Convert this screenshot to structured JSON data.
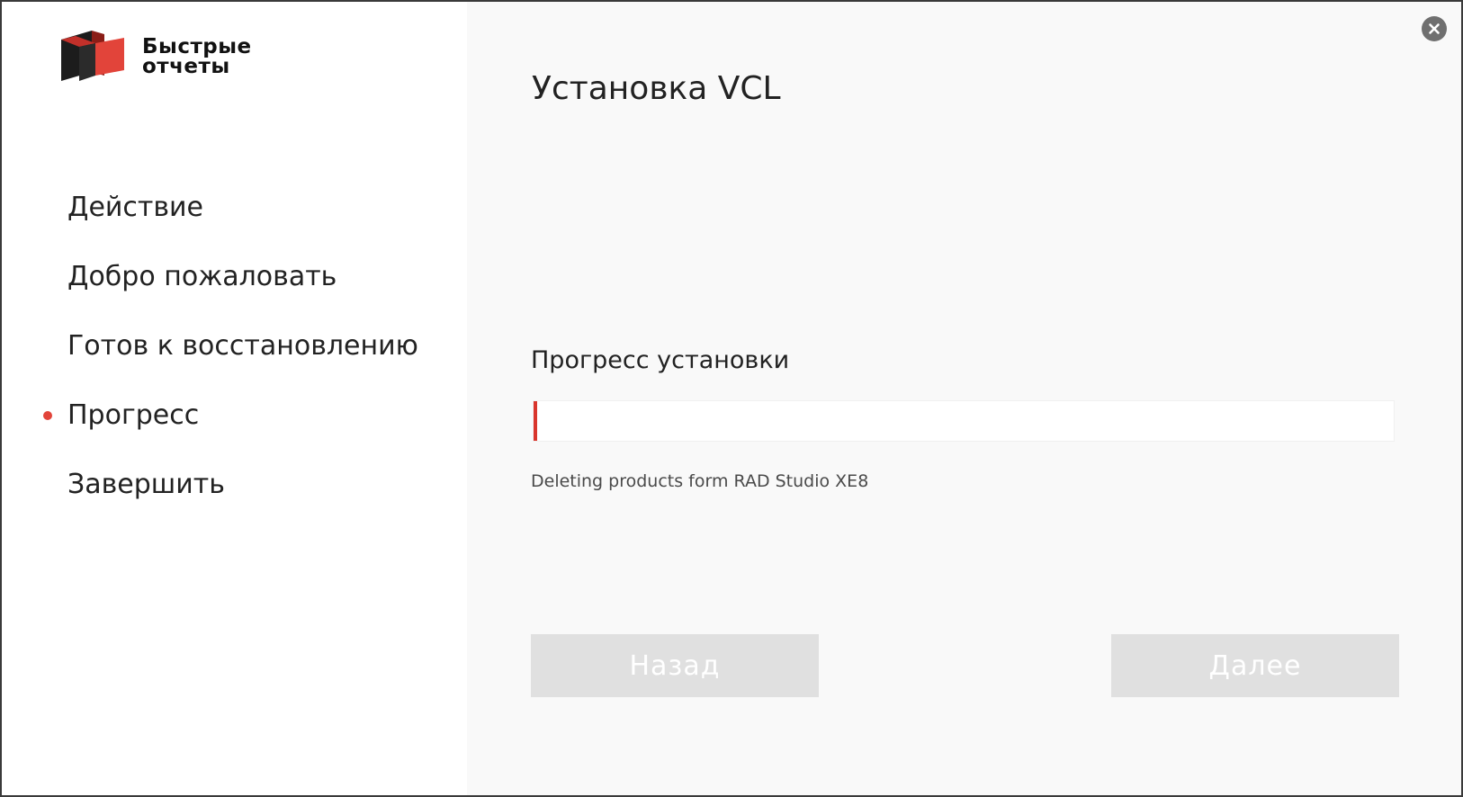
{
  "logo": {
    "line1": "Быстрые",
    "line2": "отчеты",
    "colors": {
      "red": "#e2443a",
      "dark": "#1c1c1c"
    }
  },
  "sidebar": {
    "items": [
      {
        "label": "Действие",
        "active": false
      },
      {
        "label": "Добро пожаловать",
        "active": false
      },
      {
        "label": "Готов к восстановлению",
        "active": false
      },
      {
        "label": "Прогресс",
        "active": true
      },
      {
        "label": "Завершить",
        "active": false
      }
    ]
  },
  "main": {
    "title": "Установка VCL",
    "progress_label": "Прогресс установки",
    "progress_percent": 0.4,
    "status_text": "Deleting products form RAD Studio XE8"
  },
  "buttons": {
    "back_label": "Назад",
    "next_label": "Далее"
  },
  "icons": {
    "close": "close-icon",
    "logo": "logo-icon",
    "active_step": "bullet-icon"
  },
  "colors": {
    "accent": "#e2443a",
    "main_bg": "#f9f9f9",
    "button_disabled": "#e0e0e0"
  }
}
